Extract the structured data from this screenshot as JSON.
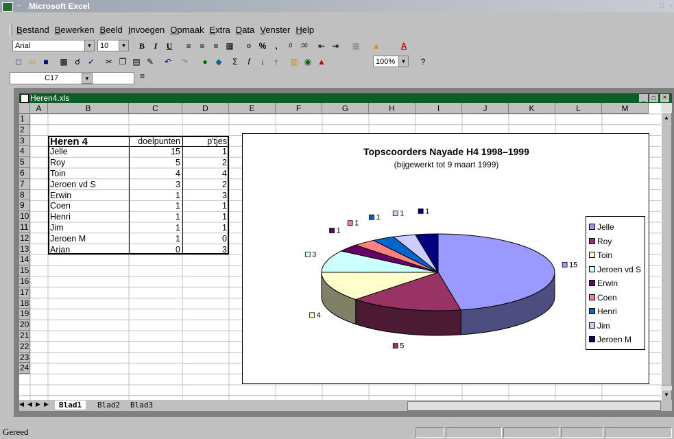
{
  "app": {
    "title": "Microsoft Excel"
  },
  "menu": [
    "Bestand",
    "Bewerken",
    "Beeld",
    "Invoegen",
    "Opmaak",
    "Extra",
    "Data",
    "Venster",
    "Help"
  ],
  "format_toolbar": {
    "font": "Arial",
    "size": "10",
    "bold": "B",
    "italic": "I",
    "underline": "U",
    "percent": "%",
    "comma": ","
  },
  "std_toolbar": {
    "zoom": "100%"
  },
  "formula_bar": {
    "name_box": "C17",
    "equals": "="
  },
  "workbook": {
    "title": "Heren4.xls"
  },
  "columns": [
    "A",
    "B",
    "C",
    "D",
    "E",
    "F",
    "G",
    "H",
    "I",
    "J",
    "K",
    "L",
    "M"
  ],
  "rows": [
    "1",
    "2",
    "3",
    "4",
    "5",
    "6",
    "7",
    "8",
    "9",
    "10",
    "11",
    "12",
    "13",
    "14",
    "15",
    "16",
    "17",
    "18",
    "19",
    "20",
    "21",
    "22",
    "23",
    "24"
  ],
  "table": {
    "header": {
      "name": "Heren 4",
      "goals": "doelpunten",
      "points": "p'tjes"
    },
    "rows": [
      {
        "name": "Jelle",
        "goals": "15",
        "points": "1"
      },
      {
        "name": "Roy",
        "goals": "5",
        "points": "2"
      },
      {
        "name": "Toin",
        "goals": "4",
        "points": "4"
      },
      {
        "name": "Jeroen vd S",
        "goals": "3",
        "points": "2"
      },
      {
        "name": "Erwin",
        "goals": "1",
        "points": "3"
      },
      {
        "name": "Coen",
        "goals": "1",
        "points": "1"
      },
      {
        "name": "Henri",
        "goals": "1",
        "points": "1"
      },
      {
        "name": "Jim",
        "goals": "1",
        "points": "1"
      },
      {
        "name": "Jeroen M",
        "goals": "1",
        "points": "0"
      },
      {
        "name": "Arjan",
        "goals": "0",
        "points": "3"
      }
    ]
  },
  "chart_data": {
    "type": "pie",
    "title": "Topscoorders Nayade H4 1998–1999",
    "subtitle": "(bijgewerkt tot 9 maart 1999)",
    "legend_position": "right",
    "categories": [
      "Jelle",
      "Roy",
      "Toin",
      "Jeroen vd S",
      "Erwin",
      "Coen",
      "Henri",
      "Jim",
      "Jeroen M"
    ],
    "values": [
      15,
      5,
      4,
      3,
      1,
      1,
      1,
      1,
      1
    ],
    "colors": [
      "#9999ff",
      "#993366",
      "#ffffcc",
      "#ccffff",
      "#660066",
      "#ff8080",
      "#0066cc",
      "#ccccff",
      "#000080"
    ],
    "labels": [
      "15",
      "5",
      "4",
      "3",
      "1",
      "1",
      "1",
      "1",
      "1"
    ]
  },
  "sheet_tabs": [
    "Blad1",
    "Blad2",
    "Blad3"
  ],
  "status": {
    "text": "Gereed"
  }
}
